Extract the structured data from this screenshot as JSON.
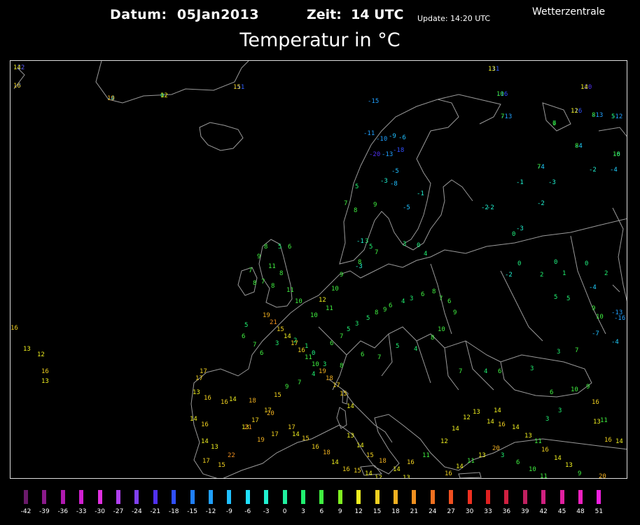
{
  "header": {
    "date_label": "Datum:",
    "date_value": "05Jan2013",
    "time_label": "Zeit:",
    "time_value": "14 UTC",
    "update": "Update: 14:20 UTC",
    "brand": "Wetterzentrale",
    "title": "Temperatur in °C"
  },
  "colors": {
    "coast": "#9a9a9a",
    "frame": "#dddddd",
    "background": "#000000"
  },
  "legend": [
    {
      "v": "-42",
      "c": "#6a1a6a"
    },
    {
      "v": "-39",
      "c": "#8a1a8a"
    },
    {
      "v": "-36",
      "c": "#b01ab0"
    },
    {
      "v": "-33",
      "c": "#d020d0"
    },
    {
      "v": "-30",
      "c": "#e030e0"
    },
    {
      "v": "-27",
      "c": "#b040f0"
    },
    {
      "v": "-24",
      "c": "#8040f0"
    },
    {
      "v": "-21",
      "c": "#5030f0"
    },
    {
      "v": "-18",
      "c": "#3050ff"
    },
    {
      "v": "-15",
      "c": "#2080ff"
    },
    {
      "v": "-12",
      "c": "#20a0ff"
    },
    {
      "v": "-9",
      "c": "#20c0ff"
    },
    {
      "v": "-6",
      "c": "#20e0ff"
    },
    {
      "v": "-3",
      "c": "#20f0d0"
    },
    {
      "v": "0",
      "c": "#20f0a0"
    },
    {
      "v": "3",
      "c": "#20f070"
    },
    {
      "v": "6",
      "c": "#40f040"
    },
    {
      "v": "9",
      "c": "#80f020"
    },
    {
      "v": "12",
      "c": "#f0f020"
    },
    {
      "v": "15",
      "c": "#f0d020"
    },
    {
      "v": "18",
      "c": "#f0b020"
    },
    {
      "v": "21",
      "c": "#f09020"
    },
    {
      "v": "24",
      "c": "#f07020"
    },
    {
      "v": "27",
      "c": "#f05020"
    },
    {
      "v": "30",
      "c": "#f03020"
    },
    {
      "v": "33",
      "c": "#e02020"
    },
    {
      "v": "36",
      "c": "#d02040"
    },
    {
      "v": "39",
      "c": "#c02060"
    },
    {
      "v": "42",
      "c": "#d02080"
    },
    {
      "v": "45",
      "c": "#e020a0"
    },
    {
      "v": "48",
      "c": "#f020c0"
    },
    {
      "v": "51",
      "c": "#f020e0"
    }
  ],
  "observations": [
    {
      "t": "-22",
      "c": "#6060ff"
    },
    {
      "t": "-8",
      "c": "#3060ff"
    },
    {
      "t": "-4",
      "c": "#20d0ff"
    },
    {
      "t": "0",
      "c": "#20f080"
    },
    {
      "t": "-11",
      "c": "#3060ff"
    },
    {
      "t": "-11",
      "c": "#3060ff"
    },
    {
      "t": "-20",
      "c": "#5030f0"
    },
    {
      "t": "-16",
      "c": "#3050ff"
    },
    {
      "t": "-16",
      "c": "#3050ff"
    },
    {
      "t": "-13",
      "c": "#20a0ff"
    },
    {
      "t": "-12",
      "c": "#20a0ff"
    },
    {
      "t": "-13",
      "c": "#20a0ff"
    },
    {
      "t": "7",
      "c": "#20f070"
    },
    {
      "t": "-4",
      "c": "#20d0ff"
    },
    {
      "t": "-6",
      "c": "#20c0ff"
    },
    {
      "t": "-4",
      "c": "#20d0ff"
    },
    {
      "t": "-2",
      "c": "#20f0d0"
    },
    {
      "t": "-4",
      "c": "#20d0ff"
    },
    {
      "t": "-1",
      "c": "#20f0d0"
    },
    {
      "t": "-3",
      "c": "#20f0d0"
    },
    {
      "t": "-2",
      "c": "#20f0d0"
    },
    {
      "t": "-2",
      "c": "#20f0d0"
    },
    {
      "t": "-2",
      "c": "#20f0d0"
    },
    {
      "t": "-3",
      "c": "#20f0d0"
    },
    {
      "t": "0",
      "c": "#20f080"
    },
    {
      "t": "0",
      "c": "#20f080"
    },
    {
      "t": "0",
      "c": "#20f080"
    },
    {
      "t": "0",
      "c": "#20f080"
    },
    {
      "t": "-2",
      "c": "#20f0d0"
    },
    {
      "t": "2",
      "c": "#20f070"
    },
    {
      "t": "1",
      "c": "#20f070"
    },
    {
      "t": "2",
      "c": "#20f070"
    },
    {
      "t": "-4",
      "c": "#20d0ff"
    },
    {
      "t": "5",
      "c": "#20f070"
    },
    {
      "t": "5",
      "c": "#20f070"
    },
    {
      "t": "9",
      "c": "#40f040"
    },
    {
      "t": "10",
      "c": "#40f040"
    },
    {
      "t": "-13",
      "c": "#20a0ff"
    },
    {
      "t": "-16",
      "c": "#20a0ff"
    },
    {
      "t": "-7",
      "c": "#20c0ff"
    },
    {
      "t": "-4",
      "c": "#20d0ff"
    },
    {
      "t": "3",
      "c": "#20f070"
    },
    {
      "t": "7",
      "c": "#40f040"
    },
    {
      "t": "7",
      "c": "#40f040"
    },
    {
      "t": "4",
      "c": "#20f070"
    },
    {
      "t": "6",
      "c": "#40f040"
    },
    {
      "t": "3",
      "c": "#20f070"
    },
    {
      "t": "6",
      "c": "#40f040"
    },
    {
      "t": "3",
      "c": "#20f070"
    },
    {
      "t": "10",
      "c": "#40f040"
    },
    {
      "t": "3",
      "c": "#20f070"
    },
    {
      "t": "9",
      "c": "#40f040"
    },
    {
      "t": "16",
      "c": "#f0d020"
    },
    {
      "t": "11",
      "c": "#40f040"
    },
    {
      "t": "14",
      "c": "#f0f020"
    },
    {
      "t": "13",
      "c": "#f0f020"
    },
    {
      "t": "16",
      "c": "#f0d020"
    },
    {
      "t": "14",
      "c": "#f0f020"
    },
    {
      "t": "20",
      "c": "#f0b020"
    },
    {
      "t": "-15",
      "c": "#20a0ff"
    },
    {
      "t": "-10",
      "c": "#20a0ff"
    },
    {
      "t": "-11",
      "c": "#20a0ff"
    },
    {
      "t": "-20",
      "c": "#5030f0"
    },
    {
      "t": "-13",
      "c": "#20a0ff"
    },
    {
      "t": "-18",
      "c": "#3050ff"
    },
    {
      "t": "-9",
      "c": "#20c0ff"
    },
    {
      "t": "-6",
      "c": "#20c0ff"
    },
    {
      "t": "-5",
      "c": "#20c0ff"
    },
    {
      "t": "-8",
      "c": "#20c0ff"
    },
    {
      "t": "-1",
      "c": "#20f0d0"
    },
    {
      "t": "-5",
      "c": "#20c0ff"
    },
    {
      "t": "-3",
      "c": "#20f0d0"
    },
    {
      "t": "5",
      "c": "#20f070"
    },
    {
      "t": "8",
      "c": "#40f040"
    },
    {
      "t": "9",
      "c": "#40f040"
    },
    {
      "t": "7",
      "c": "#40f040"
    },
    {
      "t": "3",
      "c": "#20f070"
    },
    {
      "t": "-1",
      "c": "#20f0d0"
    },
    {
      "t": "-3",
      "c": "#20f0d0"
    },
    {
      "t": "5",
      "c": "#20f070"
    },
    {
      "t": "3",
      "c": "#20f070"
    },
    {
      "t": "0",
      "c": "#20f080"
    },
    {
      "t": "4",
      "c": "#20f070"
    },
    {
      "t": "7",
      "c": "#40f040"
    },
    {
      "t": "8",
      "c": "#40f040"
    },
    {
      "t": "9",
      "c": "#40f040"
    },
    {
      "t": "10",
      "c": "#40f040"
    },
    {
      "t": "12",
      "c": "#f0f020"
    },
    {
      "t": "11",
      "c": "#40f040"
    },
    {
      "t": "10",
      "c": "#40f040"
    },
    {
      "t": "10",
      "c": "#40f040"
    },
    {
      "t": "11",
      "c": "#40f040"
    },
    {
      "t": "8",
      "c": "#40f040"
    },
    {
      "t": "7",
      "c": "#40f040"
    },
    {
      "t": "8",
      "c": "#40f040"
    },
    {
      "t": "11",
      "c": "#40f040"
    },
    {
      "t": "9",
      "c": "#40f040"
    },
    {
      "t": "8",
      "c": "#40f040"
    },
    {
      "t": "6",
      "c": "#40f040"
    },
    {
      "t": "5",
      "c": "#20f070"
    },
    {
      "t": "7",
      "c": "#40f040"
    },
    {
      "t": "8",
      "c": "#40f040"
    },
    {
      "t": "5",
      "c": "#20f070"
    },
    {
      "t": "6",
      "c": "#40f040"
    },
    {
      "t": "7",
      "c": "#40f040"
    },
    {
      "t": "6",
      "c": "#40f040"
    },
    {
      "t": "3",
      "c": "#20f070"
    },
    {
      "t": "2",
      "c": "#20f070"
    },
    {
      "t": "1",
      "c": "#20f070"
    },
    {
      "t": "0",
      "c": "#20f080"
    },
    {
      "t": "6",
      "c": "#40f040"
    },
    {
      "t": "7",
      "c": "#40f040"
    },
    {
      "t": "5",
      "c": "#20f070"
    },
    {
      "t": "3",
      "c": "#20f070"
    },
    {
      "t": "5",
      "c": "#20f070"
    },
    {
      "t": "8",
      "c": "#40f040"
    },
    {
      "t": "9",
      "c": "#40f040"
    },
    {
      "t": "6",
      "c": "#40f040"
    },
    {
      "t": "4",
      "c": "#20f070"
    },
    {
      "t": "3",
      "c": "#20f070"
    },
    {
      "t": "6",
      "c": "#40f040"
    },
    {
      "t": "8",
      "c": "#40f040"
    },
    {
      "t": "7",
      "c": "#40f040"
    },
    {
      "t": "6",
      "c": "#40f040"
    },
    {
      "t": "9",
      "c": "#40f040"
    },
    {
      "t": "10",
      "c": "#40f040"
    },
    {
      "t": "8",
      "c": "#40f040"
    },
    {
      "t": "4",
      "c": "#20f070"
    },
    {
      "t": "5",
      "c": "#20f070"
    },
    {
      "t": "7",
      "c": "#40f040"
    },
    {
      "t": "6",
      "c": "#40f040"
    },
    {
      "t": "8",
      "c": "#40f040"
    },
    {
      "t": "3",
      "c": "#20f070"
    },
    {
      "t": "4",
      "c": "#20f070"
    },
    {
      "t": "7",
      "c": "#40f040"
    },
    {
      "t": "9",
      "c": "#40f040"
    },
    {
      "t": "15",
      "c": "#f0d020"
    },
    {
      "t": "17",
      "c": "#f0d020"
    },
    {
      "t": "17",
      "c": "#f0d020"
    },
    {
      "t": "13",
      "c": "#f0f020"
    },
    {
      "t": "16",
      "c": "#f0d020"
    },
    {
      "t": "13",
      "c": "#f0f020"
    },
    {
      "t": "12",
      "c": "#f0f020"
    },
    {
      "t": "16",
      "c": "#f0d020"
    },
    {
      "t": "13",
      "c": "#f0f020"
    },
    {
      "t": "17",
      "c": "#f0d020"
    },
    {
      "t": "17",
      "c": "#f0d020"
    },
    {
      "t": "13",
      "c": "#f0f020"
    },
    {
      "t": "16",
      "c": "#f0d020"
    },
    {
      "t": "14",
      "c": "#f0f020"
    },
    {
      "t": "16",
      "c": "#f0d020"
    },
    {
      "t": "14",
      "c": "#f0f020"
    },
    {
      "t": "13",
      "c": "#f0f020"
    },
    {
      "t": "22",
      "c": "#f09020"
    },
    {
      "t": "15",
      "c": "#f0d020"
    },
    {
      "t": "17",
      "c": "#f0d020"
    },
    {
      "t": "16",
      "c": "#f0d020"
    },
    {
      "t": "14",
      "c": "#f0f020"
    },
    {
      "t": "18",
      "c": "#f0b020"
    },
    {
      "t": "20",
      "c": "#f0b020"
    },
    {
      "t": "21",
      "c": "#f09020"
    },
    {
      "t": "19",
      "c": "#f0b020"
    },
    {
      "t": "17",
      "c": "#f0d020"
    },
    {
      "t": "17",
      "c": "#f0d020"
    },
    {
      "t": "14",
      "c": "#f0f020"
    },
    {
      "t": "15",
      "c": "#f0d020"
    },
    {
      "t": "16",
      "c": "#f0d020"
    },
    {
      "t": "18",
      "c": "#f0b020"
    },
    {
      "t": "14",
      "c": "#f0f020"
    },
    {
      "t": "16",
      "c": "#f0d020"
    },
    {
      "t": "15",
      "c": "#f0d020"
    },
    {
      "t": "14",
      "c": "#f0f020"
    },
    {
      "t": "12",
      "c": "#f0f020"
    },
    {
      "t": "13",
      "c": "#f0f020"
    },
    {
      "t": "14",
      "c": "#f0f020"
    },
    {
      "t": "15",
      "c": "#f0d020"
    },
    {
      "t": "18",
      "c": "#f0b020"
    },
    {
      "t": "14",
      "c": "#f0f020"
    },
    {
      "t": "13",
      "c": "#f0f020"
    },
    {
      "t": "16",
      "c": "#f0d020"
    },
    {
      "t": "11",
      "c": "#40f040"
    },
    {
      "t": "12",
      "c": "#f0f020"
    },
    {
      "t": "14",
      "c": "#f0f020"
    },
    {
      "t": "12",
      "c": "#f0f020"
    },
    {
      "t": "13",
      "c": "#f0f020"
    },
    {
      "t": "14",
      "c": "#f0f020"
    },
    {
      "t": "16",
      "c": "#f0d020"
    },
    {
      "t": "14",
      "c": "#f0f020"
    },
    {
      "t": "13",
      "c": "#f0f020"
    },
    {
      "t": "11",
      "c": "#40f040"
    },
    {
      "t": "16",
      "c": "#f0d020"
    },
    {
      "t": "14",
      "c": "#f0f020"
    },
    {
      "t": "13",
      "c": "#f0f020"
    },
    {
      "t": "9",
      "c": "#40f040"
    },
    {
      "t": "3",
      "c": "#20f070"
    },
    {
      "t": "6",
      "c": "#40f040"
    },
    {
      "t": "10",
      "c": "#40f040"
    },
    {
      "t": "11",
      "c": "#40f040"
    },
    {
      "t": "16",
      "c": "#f0d020"
    },
    {
      "t": "14",
      "c": "#f0f020"
    },
    {
      "t": "11",
      "c": "#40f040"
    },
    {
      "t": "13",
      "c": "#f0f020"
    },
    {
      "t": "20",
      "c": "#f0b020"
    },
    {
      "t": "14",
      "c": "#f0f020"
    },
    {
      "t": "15",
      "c": "#f0d020"
    },
    {
      "t": "17",
      "c": "#f0d020"
    },
    {
      "t": "18",
      "c": "#f0b020"
    },
    {
      "t": "19",
      "c": "#f0b020"
    },
    {
      "t": "10",
      "c": "#40f040"
    },
    {
      "t": "11",
      "c": "#40f040"
    },
    {
      "t": "16",
      "c": "#f0d020"
    },
    {
      "t": "17",
      "c": "#f0d020"
    },
    {
      "t": "14",
      "c": "#f0f020"
    },
    {
      "t": "15",
      "c": "#f0d020"
    },
    {
      "t": "21",
      "c": "#f09020"
    },
    {
      "t": "19",
      "c": "#f0b020"
    },
    {
      "t": "14",
      "c": "#f0f020"
    },
    {
      "t": "16",
      "c": "#f0d020"
    },
    {
      "t": "19",
      "c": "#f0b020"
    },
    {
      "t": "12",
      "c": "#f0f020"
    },
    {
      "t": "13",
      "c": "#f0f020"
    },
    {
      "t": "15",
      "c": "#f0d020"
    },
    {
      "t": "14",
      "c": "#f0f020"
    },
    {
      "t": "10",
      "c": "#40f040"
    },
    {
      "t": "12",
      "c": "#f0f020"
    },
    {
      "t": "7",
      "c": "#40f040"
    },
    {
      "t": "5",
      "c": "#20f070"
    },
    {
      "t": "8",
      "c": "#40f040"
    },
    {
      "t": "6",
      "c": "#40f040"
    },
    {
      "t": "8",
      "c": "#40f040"
    },
    {
      "t": "10",
      "c": "#40f040"
    },
    {
      "t": "7",
      "c": "#40f040"
    }
  ]
}
